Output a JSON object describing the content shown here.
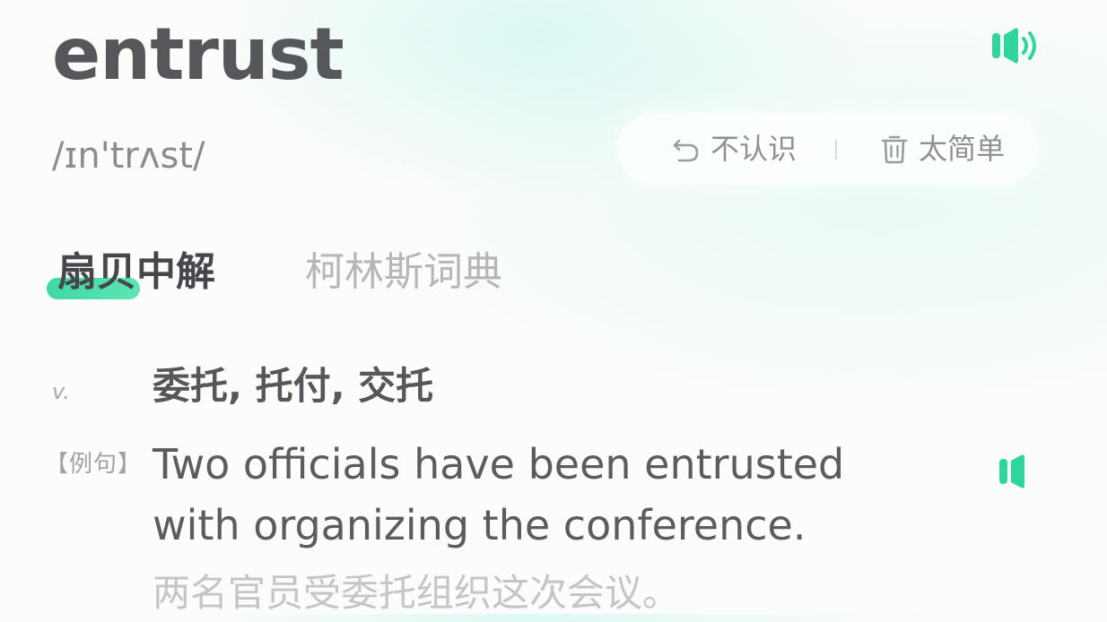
{
  "word": {
    "headword": "entrust",
    "phonetic": "/ɪn'trʌst/"
  },
  "actions": {
    "unknown_label": "不认识",
    "too_easy_label": "太简单"
  },
  "tabs": {
    "shanbay": "扇贝中解",
    "collins": "柯林斯词典"
  },
  "sense": {
    "pos": "v.",
    "definition": "委托, 托付, 交托"
  },
  "example": {
    "tag": "【例句】",
    "english": "Two officials have been entrusted with organizing the conference.",
    "chinese": "两名官员受委托组织这次会议。"
  },
  "colors": {
    "accent": "#2fd59c",
    "text_primary": "#55575b",
    "text_muted": "#8e9094"
  },
  "icons": {
    "main_speaker": "speaker-icon",
    "example_speaker": "speaker-icon",
    "undo": "undo-icon",
    "trash": "trash-icon"
  }
}
